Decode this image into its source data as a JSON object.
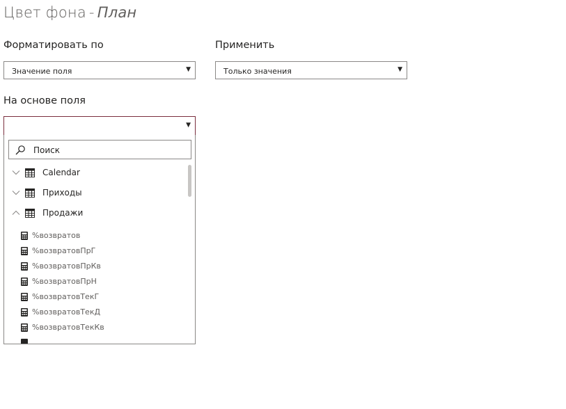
{
  "header": {
    "title": "Цвет фона",
    "separator": "-",
    "measure": "План"
  },
  "format_by": {
    "label": "Форматировать по",
    "value": "Значение поля"
  },
  "apply_to": {
    "label": "Применить",
    "value": "Только значения"
  },
  "based_on": {
    "label": "На основе поля",
    "value": "",
    "search_placeholder": "Поиск",
    "tables": [
      {
        "name": "Calendar",
        "expanded": false
      },
      {
        "name": "Приходы",
        "expanded": false
      },
      {
        "name": "Продажи",
        "expanded": true
      }
    ],
    "fields": [
      "%возвратов",
      "%возвратовПрГ",
      "%возвратовПрКв",
      "%возвратовПрН",
      "%возвратовТекГ",
      "%возвратовТекД",
      "%возвратовТекКв"
    ]
  },
  "icons": {
    "caret": "caret-down-icon",
    "search": "magnifier-icon",
    "table": "table-icon",
    "measure": "calculator-icon",
    "chevron_collapsed": "chevron-down-icon",
    "chevron_expanded": "chevron-up-icon"
  },
  "colors": {
    "active_border": "#7a2e3e",
    "border": "#8a8886",
    "text": "#252423"
  }
}
